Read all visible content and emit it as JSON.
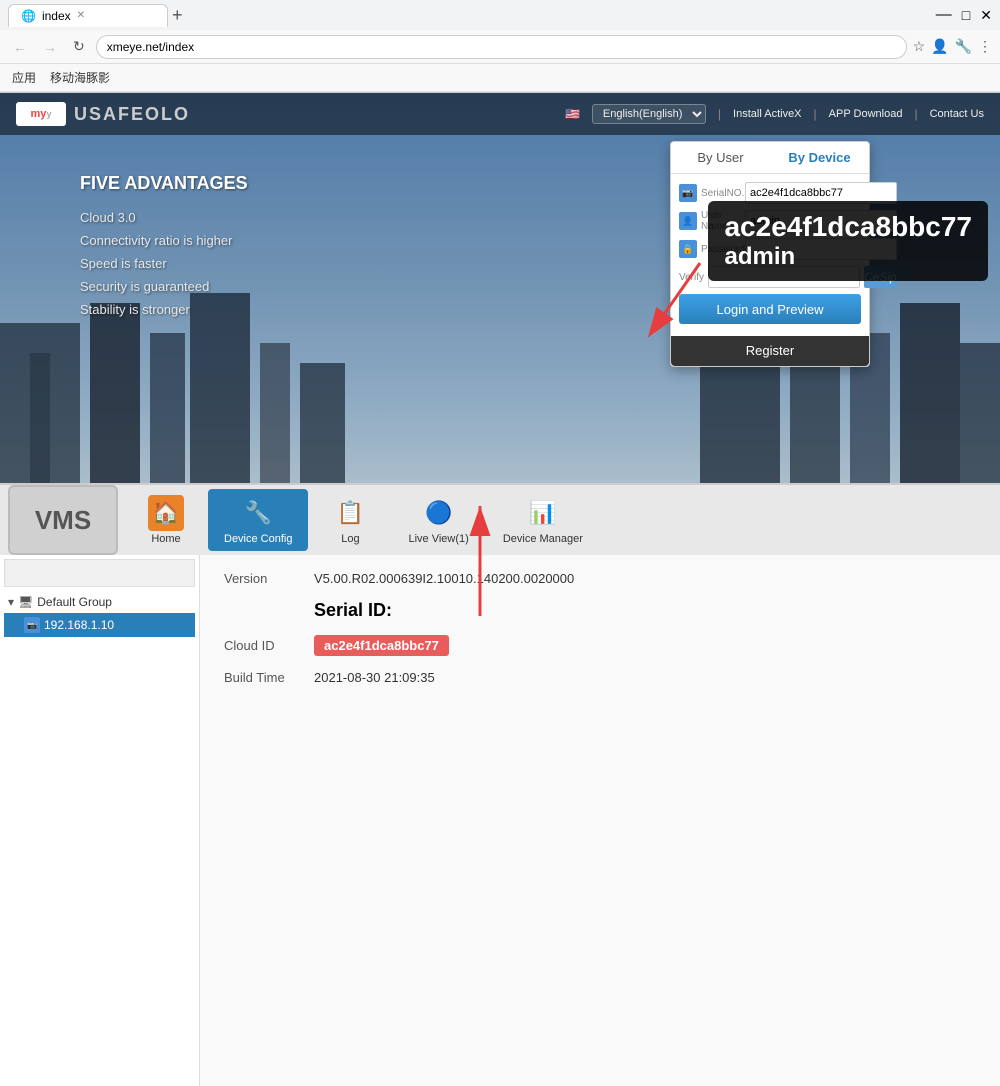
{
  "browser": {
    "tab_title": "index",
    "address": "xmeye.net/index",
    "bookmark": "移动海豚影"
  },
  "site": {
    "logo_text": "my_y",
    "brand_name": "USAFEOLO",
    "lang": "English(English)",
    "install_activex": "Install ActiveX",
    "app_download": "APP Download",
    "contact_us": "Contact Us"
  },
  "advantages": {
    "title": "FIVE ADVANTAGES",
    "items": [
      "Cloud 3.0",
      "Connectivity ratio is higher",
      "Speed is faster",
      "Security is guaranteed",
      "Stability is stronger"
    ]
  },
  "login_popup": {
    "tab_by_user": "By User",
    "tab_by_device": "By Device",
    "active_tab": "By Device",
    "serial_no_label": "SerialNO.",
    "serial_no_value": "ac2e4f1dca8bbc77",
    "user_name_label": "User Name",
    "user_name_value": "admin",
    "password_label": "Password",
    "password_value": "",
    "verify_label": "Verify",
    "verify_code": "CeSip",
    "login_btn": "Login and Preview",
    "register_btn": "Register"
  },
  "annotation": {
    "serial": "ac2e4f1dca8bbc77",
    "username": "admin"
  },
  "vms": {
    "logo": "VMS",
    "nav_items": [
      {
        "id": "home",
        "label": "Home",
        "icon": "🏠",
        "active": false
      },
      {
        "id": "device-config",
        "label": "Device Config",
        "icon": "🔧",
        "active": true
      },
      {
        "id": "log",
        "label": "Log",
        "icon": "📋",
        "active": false
      },
      {
        "id": "live-view",
        "label": "Live View(1)",
        "icon": "🔵",
        "active": false
      },
      {
        "id": "device-manager",
        "label": "Device Manager",
        "icon": "📊",
        "active": false
      }
    ]
  },
  "sidebar": {
    "group_label": "Default Group",
    "device_ip": "192.168.1.10"
  },
  "detail": {
    "version_label": "Version",
    "version_value": "V5.00.R02.000639I2.10010.140200.0020000",
    "serial_id_heading": "Serial ID:",
    "cloud_id_label": "Cloud ID",
    "cloud_id_value": "ac2e4f1dca8bbc77",
    "build_time_label": "Build Time",
    "build_time_value": "2021-08-30 21:09:35"
  }
}
